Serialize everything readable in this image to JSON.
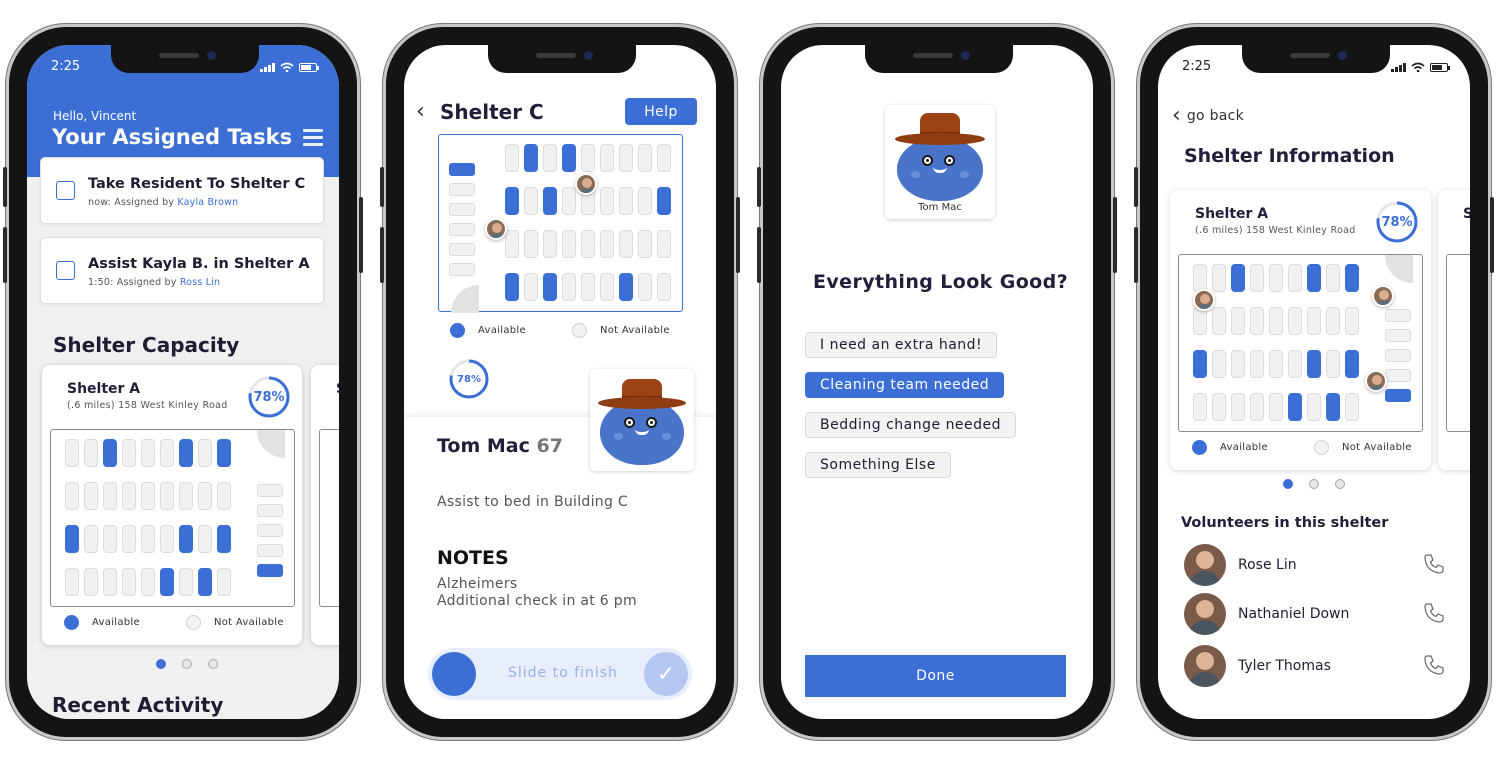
{
  "colors": {
    "accent": "#3b6fd6",
    "card_bg": "#ffffff",
    "header_blue": "#3b6fd6"
  },
  "screen1": {
    "time": "2:25",
    "greeting": "Hello, Vincent",
    "title": "Your Assigned Tasks",
    "tasks": [
      {
        "title": "Take Resident To Shelter C",
        "prefix": "now: Assigned by ",
        "assignee": "Kayla Brown"
      },
      {
        "title": "Assist Kayla B. in Shelter A",
        "prefix": "1:50: Assigned by ",
        "assignee": "Ross Lin"
      }
    ],
    "capacity_heading": "Shelter Capacity",
    "shelter": {
      "name": "Shelter A",
      "distance": "(.6 miles) 158 West Kinley Road",
      "percent": "78%",
      "fill": 0.78
    },
    "peek_initial": "S",
    "legend": {
      "available": "Available",
      "not_available": "Not Available"
    },
    "recent_heading": "Recent Activity",
    "page_index": 0,
    "page_count": 3
  },
  "screen2": {
    "title": "Shelter C",
    "help": "Help",
    "legend": {
      "available": "Available",
      "not_available": "Not Available"
    },
    "percent": "78%",
    "fill": 0.78,
    "resident_name": "Tom Mac",
    "resident_age": "67",
    "task": "Assist to bed in Building C",
    "notes_heading": "NOTES",
    "notes": [
      "Alzheimers",
      "Additional check in at 6 pm"
    ],
    "slide_label": "Slide to finish"
  },
  "screen3": {
    "avatar_name": "Tom Mac",
    "question": "Everything Look Good?",
    "options": [
      {
        "label": "I need an extra hand!",
        "selected": false
      },
      {
        "label": "Cleaning team needed",
        "selected": true
      },
      {
        "label": "Bedding change needed",
        "selected": false
      },
      {
        "label": "Something Else",
        "selected": false
      }
    ],
    "done": "Done"
  },
  "screen4": {
    "time": "2:25",
    "back": "go back",
    "title": "Shelter Information",
    "shelter": {
      "name": "Shelter A",
      "distance": "(.6 miles) 158 West Kinley Road",
      "percent": "78%",
      "fill": 0.78
    },
    "peek_initial": "S",
    "legend": {
      "available": "Available",
      "not_available": "Not Available"
    },
    "page_index": 0,
    "page_count": 3,
    "volunteers_heading": "Volunteers in this shelter",
    "volunteers": [
      {
        "name": "Rose Lin"
      },
      {
        "name": "Nathaniel Down"
      },
      {
        "name": "Tyler Thomas"
      }
    ]
  }
}
